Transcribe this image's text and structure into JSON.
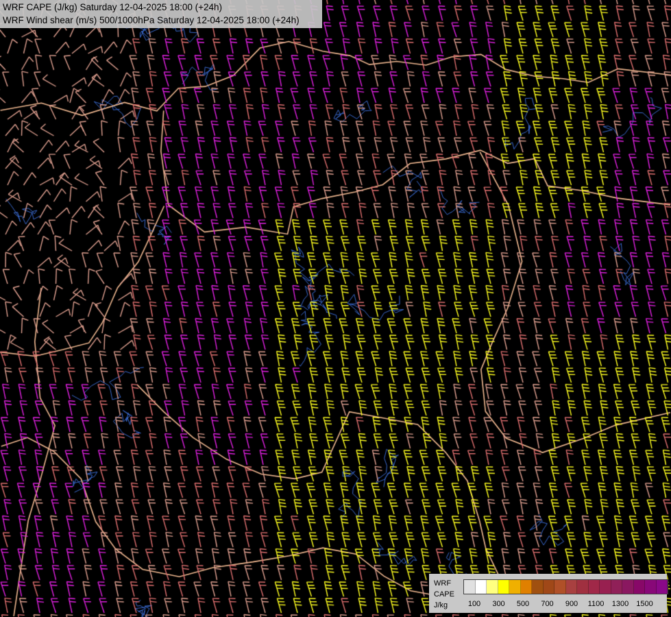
{
  "header": {
    "title_line_1": "WRF CAPE (J/kg) Saturday 12-04-2025 18:00 (+24h)",
    "title_line_2": "WRF Wind shear (m/s) 500/1000hPa Saturday 12-04-2025 18:00 (+24h)"
  },
  "legend": {
    "label_model": "WRF",
    "label_field": "CAPE",
    "label_unit": "J/kg",
    "colors": [
      "#e0e0e0",
      "#ffffff",
      "#ffff80",
      "#ffff00",
      "#f0b000",
      "#e08000",
      "#a05010",
      "#a04818",
      "#b05028",
      "#a84040",
      "#a03040",
      "#a02848",
      "#982050",
      "#902058",
      "#8a1860",
      "#880868",
      "#880878",
      "#8a0888"
    ],
    "tick_labels": [
      "100",
      "300",
      "500",
      "700",
      "900",
      "1100",
      "1300",
      "1500"
    ]
  },
  "map": {
    "background": "#000000",
    "border_color": "#f0b890",
    "river_color": "#3a6ad0",
    "barb_colors": {
      "low_shear": "#e0a090",
      "mid_shear": "#e07070",
      "high_shear_magenta": "#e020e0",
      "cape_yellow": "#ffff20"
    }
  }
}
